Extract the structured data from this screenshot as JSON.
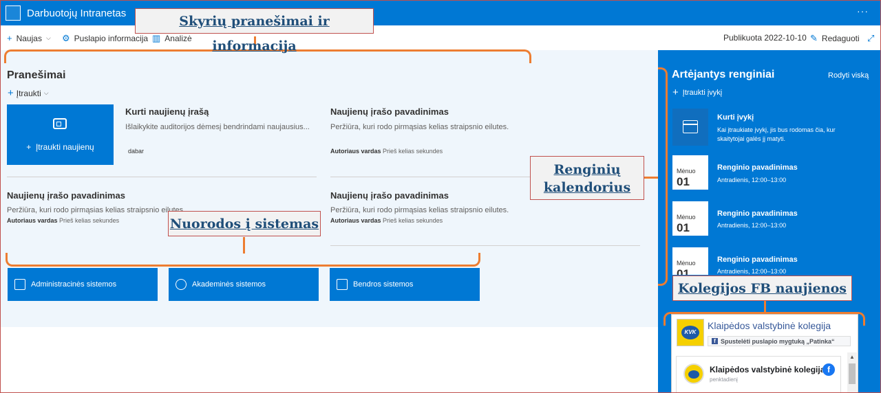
{
  "suite": {
    "title": "Darbuotojų Intranetas",
    "more": "···"
  },
  "cmdbar": {
    "new": "Naujas",
    "page_info": "Puslapio informacija",
    "analytics": "Analizė",
    "published": "Publikuota 2022-10-10",
    "edit": "Redaguoti"
  },
  "news": {
    "title": "Pranešimai",
    "add": "Įtraukti",
    "hero_label": "Įtraukti naujienų",
    "items": [
      {
        "title": "Kurti naujienų įrašą",
        "desc": "Išlaikykite auditorijos dėmesį bendrindami naujausius...",
        "author": "",
        "time": "dabar"
      },
      {
        "title": "Naujienų įrašo pavadinimas",
        "desc": "Peržiūra, kuri rodo pirmąsias kelias straipsnio eilutes.",
        "author": "Autoriaus vardas",
        "time": "Prieš kelias sekundes"
      },
      {
        "title": "Naujienų įrašo pavadinimas",
        "desc": "Peržiūra, kuri rodo pirmąsias kelias straipsnio eilutes.",
        "author": "Autoriaus vardas",
        "time": "Prieš kelias sekundes"
      },
      {
        "title": "Naujienų įrašo pavadinimas",
        "desc": "Peržiūra, kuri rodo pirmąsias kelias straipsnio eilutes.",
        "author": "Autoriaus vardas",
        "time": "Prieš kelias sekundes"
      }
    ]
  },
  "quicklinks": [
    {
      "label": "Administracinės sistemos"
    },
    {
      "label": "Akademinės sistemos"
    },
    {
      "label": "Bendros sistemos"
    }
  ],
  "events": {
    "title": "Artėjantys renginiai",
    "see_all": "Rodyti viską",
    "add": "Įtraukti įvykį",
    "create_title": "Kurti įvykį",
    "create_desc": "Kai įtraukiate įvykį, jis bus rodomas čia, kur skaitytojai galės jį matyti.",
    "items": [
      {
        "month": "Mėnuo",
        "day": "01",
        "title": "Renginio pavadinimas",
        "time": "Antradienis, 12:00–13:00"
      },
      {
        "month": "Mėnuo",
        "day": "01",
        "title": "Renginio pavadinimas",
        "time": "Antradienis, 12:00–13:00"
      },
      {
        "month": "Mėnuo",
        "day": "01",
        "title": "Renginio pavadinimas",
        "time": "Antradienis, 12:00–13:00"
      }
    ]
  },
  "fb": {
    "logo_text": "KVK",
    "page_name": "Klaipėdos valstybinė kolegija",
    "like_text": "Spustelėti puslapio mygtuką „Patinka“",
    "post_name": "Klaipėdos valstybinė kolegija",
    "post_date": "penktadienį"
  },
  "annotations": {
    "sections": "Skyrių pranešimai ir informacija",
    "calendar": "Renginių kalendorius",
    "links": "Nuorodos į sistemas",
    "fb": "Kolegijos FB naujienos"
  },
  "colors": {
    "brand": "#0078d4",
    "accent_orange": "#ed7d31",
    "callout_text": "#1f4e79"
  }
}
